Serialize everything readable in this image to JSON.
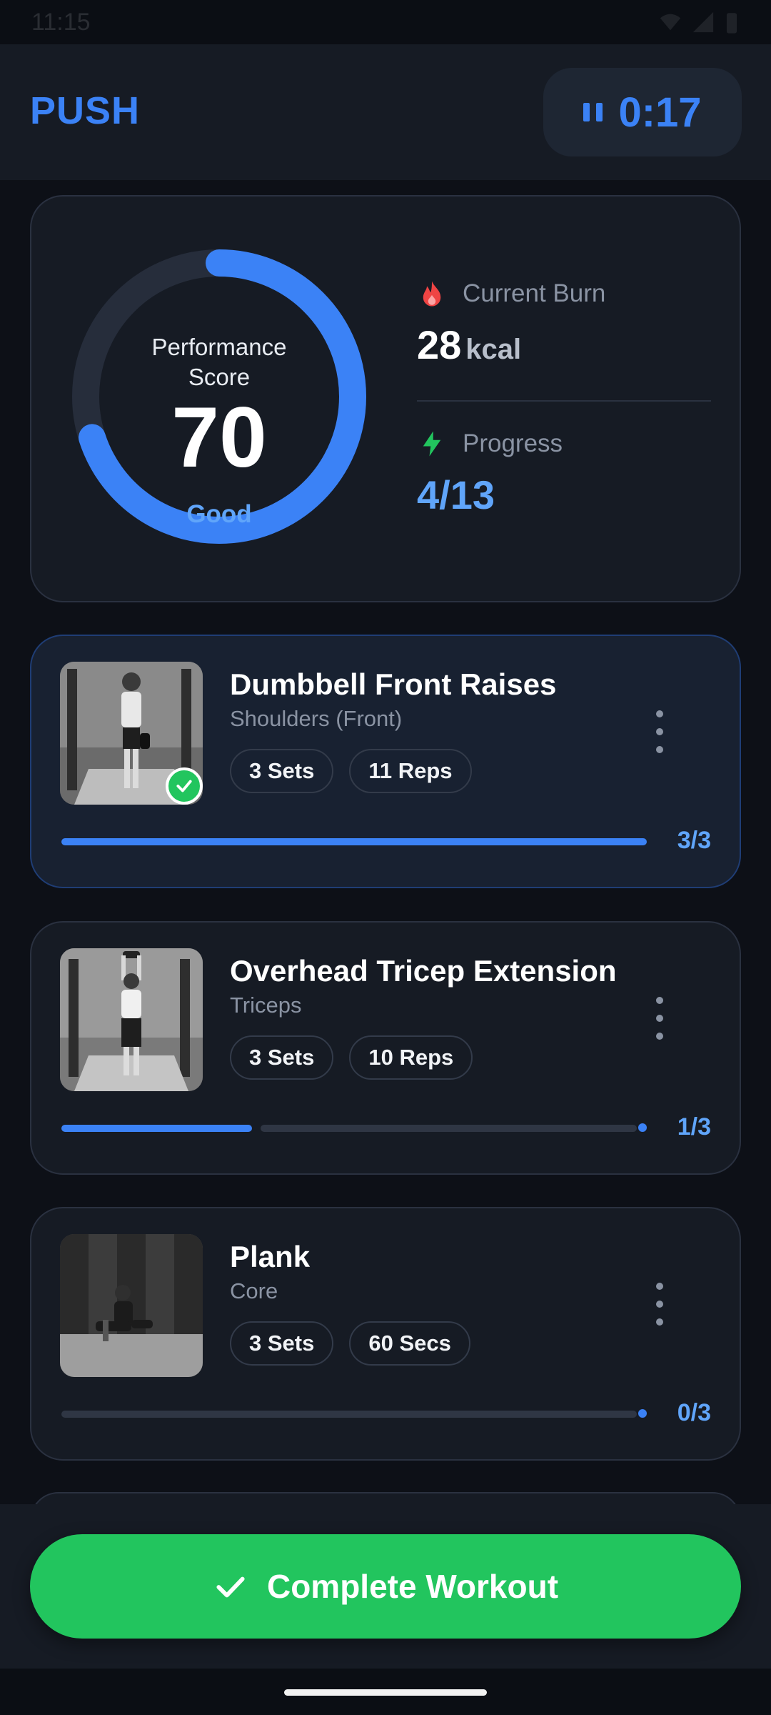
{
  "status": {
    "time": "11:15"
  },
  "header": {
    "title": "PUSH",
    "timer": "0:17"
  },
  "stats": {
    "score_label": "Performance\nScore",
    "score_label_line1": "Performance",
    "score_label_line2": "Score",
    "score": "70",
    "score_value": 70,
    "rating": "Good",
    "burn_label": "Current Burn",
    "burn_value": "28",
    "burn_unit": "kcal",
    "progress_label": "Progress",
    "progress_value": "4/13"
  },
  "exercises": [
    {
      "name": "Dumbbell Front Raises",
      "muscle": "Shoulders (Front)",
      "sets": "3 Sets",
      "reps": "11 Reps",
      "count": "3/3",
      "progress_fraction": 1.0,
      "completed": true
    },
    {
      "name": "Overhead Tricep Extension",
      "muscle": "Triceps",
      "sets": "3 Sets",
      "reps": "10 Reps",
      "count": "1/3",
      "progress_fraction": 0.3333,
      "completed": false
    },
    {
      "name": "Plank",
      "muscle": "Core",
      "sets": "3 Sets",
      "reps": "60 Secs",
      "count": "0/3",
      "progress_fraction": 0.0,
      "completed": false
    }
  ],
  "footer": {
    "complete_label": "Complete Workout"
  },
  "colors": {
    "accent": "#3b82f6",
    "success": "#22c55e",
    "burn": "#ef4444",
    "bolt": "#22c55e"
  }
}
